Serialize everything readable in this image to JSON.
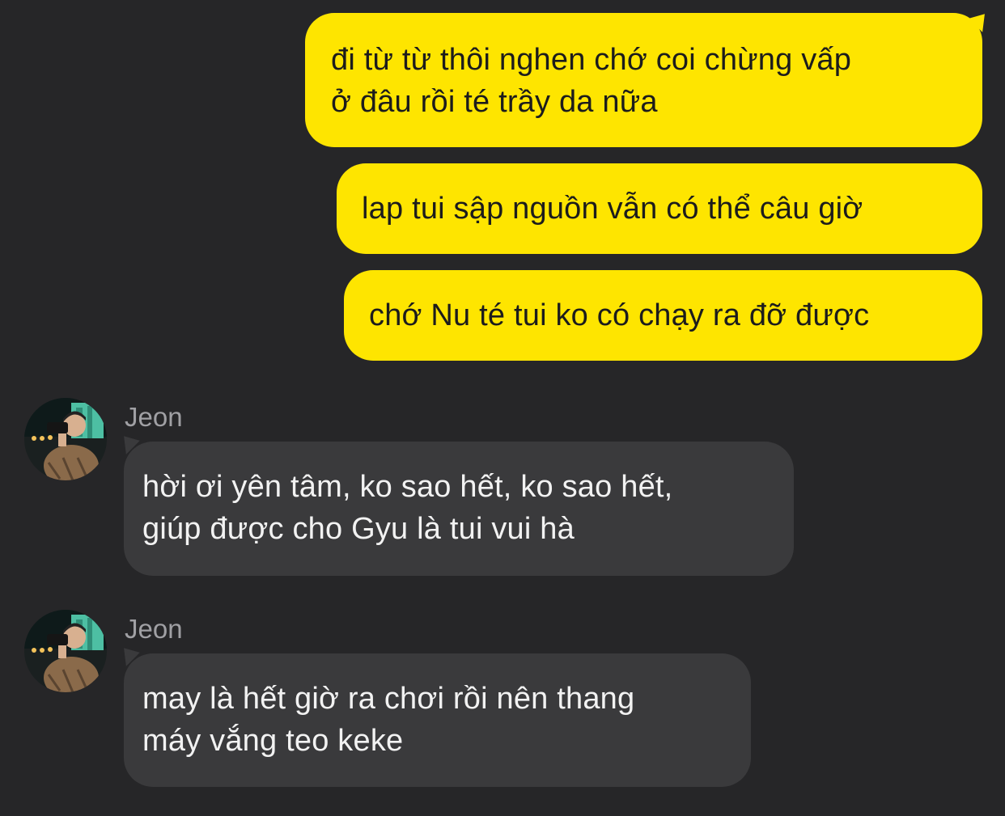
{
  "colors": {
    "background": "#262628",
    "outgoing_bubble": "#fee500",
    "incoming_bubble": "#3a3a3c",
    "outgoing_text": "#1c1c1c",
    "incoming_text": "#f2f2f2",
    "sender_name": "#a0a0a4"
  },
  "messages": [
    {
      "direction": "outgoing",
      "lines": [
        "đi từ từ thôi nghen chớ coi chừng vấp",
        "ở đâu rồi té trầy da nữa"
      ]
    },
    {
      "direction": "outgoing",
      "lines": [
        "lap tui sập nguồn vẫn có thể câu giờ"
      ]
    },
    {
      "direction": "outgoing",
      "lines": [
        "chớ Nu té tui ko có chạy ra đỡ được"
      ]
    },
    {
      "direction": "incoming",
      "sender": "Jeon",
      "avatar_icon": "profile-photo-avatar",
      "lines": [
        "hời ơi yên tâm, ko sao hết, ko sao hết,",
        "giúp được cho Gyu là tui vui hà"
      ]
    },
    {
      "direction": "incoming",
      "sender": "Jeon",
      "avatar_icon": "profile-photo-avatar",
      "lines": [
        "may là hết giờ ra chơi rồi nên thang",
        "máy vắng teo keke"
      ]
    }
  ]
}
